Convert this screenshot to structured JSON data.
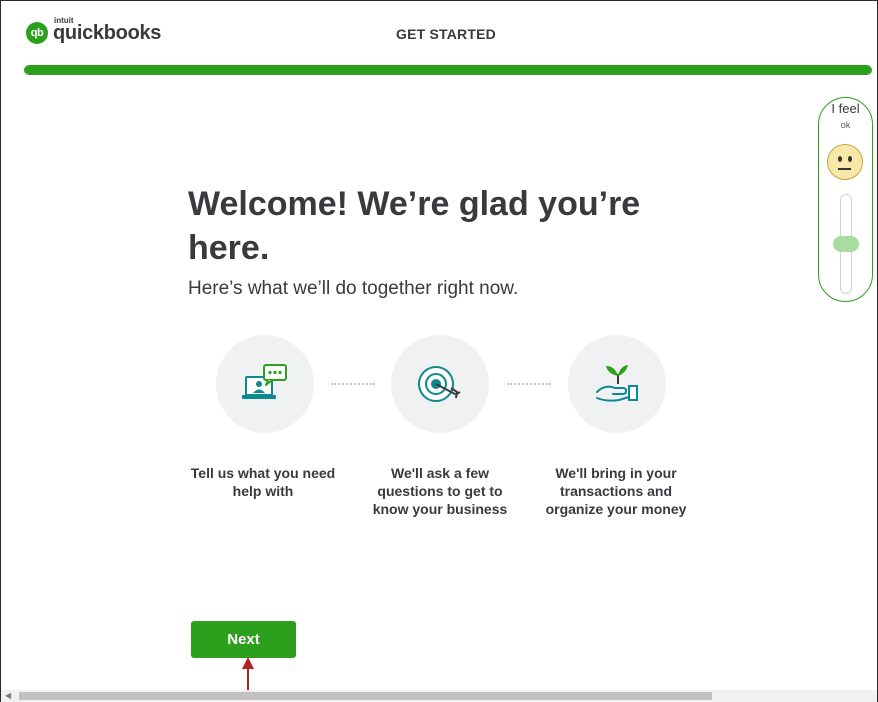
{
  "header": {
    "logo_small": "intuit",
    "logo_word": "quickbooks",
    "logo_badge": "qb",
    "title": "GET STARTED"
  },
  "progress": {
    "value": 1.0,
    "color": "#2ca01c"
  },
  "feel_widget": {
    "title": "I feel",
    "mood": "ok",
    "face_icon": "neutral-face-icon",
    "level": 0.5
  },
  "hero": {
    "heading": "Welcome! We’re glad you’re here.",
    "subtitle": "Here’s what we’ll do together right now."
  },
  "steps": [
    {
      "icon": "chat-laptop-icon",
      "text": "Tell us what you need help with"
    },
    {
      "icon": "target-icon",
      "text": "We'll ask a few questions to get to know your business"
    },
    {
      "icon": "plant-hand-icon",
      "text": "We'll bring in your transactions and organize your money"
    }
  ],
  "actions": {
    "next_label": "Next"
  },
  "colors": {
    "accent": "#2ca01c",
    "teal": "#0d8a8e",
    "arrow": "#b22222"
  }
}
